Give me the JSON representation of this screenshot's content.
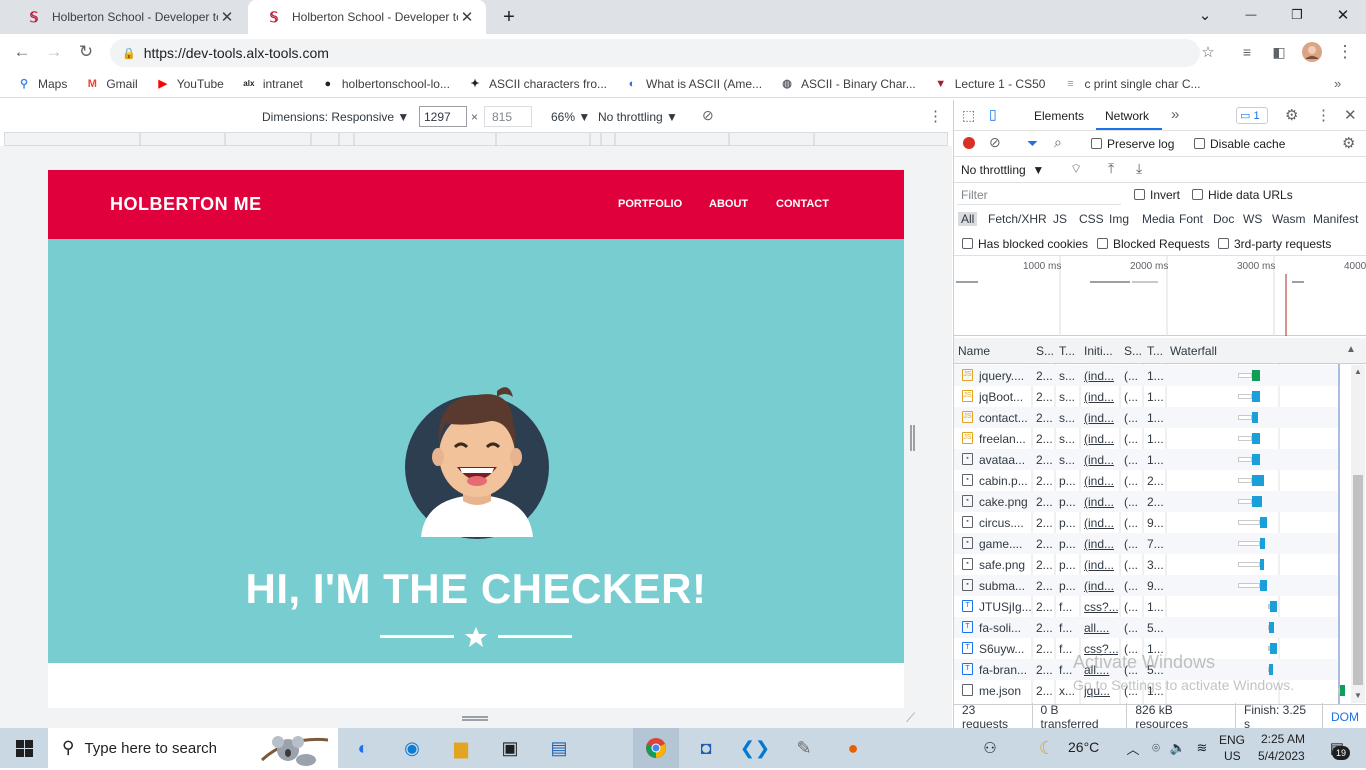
{
  "tabs": [
    {
      "title": "Holberton School - Developer to",
      "close": "✕"
    },
    {
      "title": "Holberton School - Developer to",
      "close": "✕"
    }
  ],
  "window": {
    "new_tab": "+",
    "tab_search": "⌄",
    "minimize": "—",
    "maximize": "❐",
    "close": "✕"
  },
  "address": {
    "url": "https://dev-tools.alx-tools.com"
  },
  "bookmarks": [
    {
      "label": "Maps",
      "icon": "maps-icon",
      "color": "#4285f4"
    },
    {
      "label": "Gmail",
      "icon": "gmail-icon",
      "color": "#ea4335"
    },
    {
      "label": "YouTube",
      "icon": "youtube-icon",
      "color": "#ff0000"
    },
    {
      "label": "intranet",
      "icon": "alx-icon",
      "color": "#222222"
    },
    {
      "label": "holbertonschool-lo...",
      "icon": "github-icon",
      "color": "#222222"
    },
    {
      "label": "ASCII characters fro...",
      "icon": "ascii-icon",
      "color": "#222222"
    },
    {
      "label": "What is ASCII (Ame...",
      "icon": "ascii-q-icon",
      "color": "#1a73e8"
    },
    {
      "label": "ASCII - Binary Char...",
      "icon": "globe-icon",
      "color": "#5f6368"
    },
    {
      "label": "Lecture 1 - CS50",
      "icon": "harvard-icon",
      "color": "#a51c30"
    },
    {
      "label": "c print single char C...",
      "icon": "stack-icon",
      "color": "#f48024"
    }
  ],
  "device_toolbar": {
    "dimensions": "Dimensions: Responsive ▼",
    "width": "1297",
    "times": "×",
    "height": "815",
    "zoom": "66% ▼",
    "throttle": "No throttling ▼"
  },
  "site": {
    "brand": "HOLBERTON ME",
    "nav": [
      "PORTFOLIO",
      "ABOUT",
      "CONTACT"
    ],
    "hero_title": "HI, I'M THE CHECKER!",
    "colors": {
      "nav": "#e0003c",
      "hero": "#78cdd1"
    }
  },
  "devtools": {
    "tabs": [
      "Elements",
      "Network"
    ],
    "issues_count": "1",
    "preserve_log": "Preserve log",
    "disable_cache": "Disable cache",
    "throttling": "No throttling",
    "filter_placeholder": "Filter",
    "invert": "Invert",
    "hide_data_urls": "Hide data URLs",
    "filter_types": [
      "All",
      "Fetch/XHR",
      "JS",
      "CSS",
      "Img",
      "Media",
      "Font",
      "Doc",
      "WS",
      "Wasm",
      "Manifest"
    ],
    "has_blocked_cookies": "Has blocked cookies",
    "blocked_requests": "Blocked Requests",
    "third_party": "3rd-party requests",
    "timeline_ticks": [
      "1000 ms",
      "2000 ms",
      "3000 ms",
      "4000"
    ],
    "columns": [
      "Name",
      "S...",
      "T...",
      "Initi...",
      "S...",
      "T...",
      "Waterfall"
    ],
    "requests": [
      {
        "name": "jquery....",
        "s": "2...",
        "t": "s...",
        "init": "(ind...",
        "size": "(...",
        "time": "1...",
        "type": "js"
      },
      {
        "name": "jqBoot...",
        "s": "2...",
        "t": "s...",
        "init": "(ind...",
        "size": "(...",
        "time": "1...",
        "type": "js"
      },
      {
        "name": "contact...",
        "s": "2...",
        "t": "s...",
        "init": "(ind...",
        "size": "(...",
        "time": "1...",
        "type": "js"
      },
      {
        "name": "freelan...",
        "s": "2...",
        "t": "s...",
        "init": "(ind...",
        "size": "(...",
        "time": "1...",
        "type": "js"
      },
      {
        "name": "avataa...",
        "s": "2...",
        "t": "s...",
        "init": "(ind...",
        "size": "(...",
        "time": "1...",
        "type": "img"
      },
      {
        "name": "cabin.p...",
        "s": "2...",
        "t": "p...",
        "init": "(ind...",
        "size": "(...",
        "time": "2...",
        "type": "img"
      },
      {
        "name": "cake.png",
        "s": "2...",
        "t": "p...",
        "init": "(ind...",
        "size": "(...",
        "time": "2...",
        "type": "img"
      },
      {
        "name": "circus....",
        "s": "2...",
        "t": "p...",
        "init": "(ind...",
        "size": "(...",
        "time": "9...",
        "type": "img"
      },
      {
        "name": "game....",
        "s": "2...",
        "t": "p...",
        "init": "(ind...",
        "size": "(...",
        "time": "7...",
        "type": "img"
      },
      {
        "name": "safe.png",
        "s": "2...",
        "t": "p...",
        "init": "(ind...",
        "size": "(...",
        "time": "3...",
        "type": "img"
      },
      {
        "name": "subma...",
        "s": "2...",
        "t": "p...",
        "init": "(ind...",
        "size": "(...",
        "time": "9...",
        "type": "img"
      },
      {
        "name": "JTUSjIg...",
        "s": "2...",
        "t": "f...",
        "init": "css?...",
        "size": "(...",
        "time": "1...",
        "type": "font"
      },
      {
        "name": "fa-soli...",
        "s": "2...",
        "t": "f...",
        "init": "all....",
        "size": "(...",
        "time": "5...",
        "type": "font"
      },
      {
        "name": "S6uyw...",
        "s": "2...",
        "t": "f...",
        "init": "css?...",
        "size": "(...",
        "time": "1...",
        "type": "font"
      },
      {
        "name": "fa-bran...",
        "s": "2...",
        "t": "f...",
        "init": "all....",
        "size": "(...",
        "time": "5...",
        "type": "font"
      },
      {
        "name": "me.json",
        "s": "2...",
        "t": "x...",
        "init": "jqu...",
        "size": "(...",
        "time": "1...",
        "type": "doc"
      }
    ],
    "status": {
      "requests": "23 requests",
      "transferred": "0 B transferred",
      "resources": "826 kB resources",
      "finish": "Finish: 3.25 s",
      "dom": "DOM"
    }
  },
  "watermark": {
    "line1": "Activate Windows",
    "line2": "Go to Settings to activate Windows."
  },
  "taskbar": {
    "search_placeholder": "Type here to search",
    "temperature": "26°C",
    "lang1": "ENG",
    "lang2": "US",
    "time": "2:25 AM",
    "date": "5/4/2023",
    "notifications": "19"
  }
}
